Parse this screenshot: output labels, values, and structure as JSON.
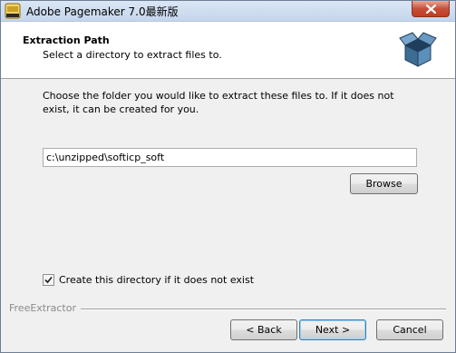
{
  "window": {
    "title": "Adobe Pagemaker 7.0最新版",
    "app_icon": "softcp-icon",
    "close_icon": "close-icon"
  },
  "header": {
    "title": "Extraction Path",
    "subtitle": "Select a directory to extract files to.",
    "icon": "open-box-icon"
  },
  "body": {
    "instruction": "Choose the folder you would like to extract these files to. If it does not exist, it can be created for you.",
    "path_value": "c:\\unzipped\\softicp_soft",
    "browse_label": "Browse",
    "create_dir_label": "Create this directory if it does not exist",
    "create_dir_checked": true
  },
  "footer": {
    "brand": "FreeExtractor",
    "back_label": "< Back",
    "next_label": "Next >",
    "cancel_label": "Cancel"
  }
}
